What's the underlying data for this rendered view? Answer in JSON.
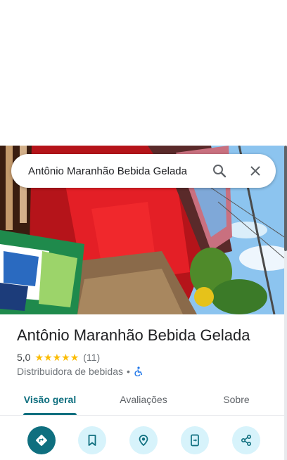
{
  "search": {
    "query": "Antônio Maranhão Bebida Gelada"
  },
  "place": {
    "name": "Antônio Maranhão Bebida Gelada",
    "rating": "5,0",
    "stars": [
      "★",
      "★",
      "★",
      "★",
      "★"
    ],
    "review_count": "(11)",
    "category": "Distribuidora de bebidas",
    "separator": "•"
  },
  "tabs": [
    {
      "label": "Visão geral",
      "active": true
    },
    {
      "label": "Avaliações",
      "active": false
    },
    {
      "label": "Sobre",
      "active": false
    }
  ],
  "actions": [
    {
      "icon": "directions-icon"
    },
    {
      "icon": "save-icon"
    },
    {
      "icon": "nearby-icon"
    },
    {
      "icon": "send-to-phone-icon"
    },
    {
      "icon": "share-icon"
    }
  ],
  "colors": {
    "accent": "#0f6f7f",
    "action_bg": "#d7f3fb",
    "star": "#fbbc04",
    "accessibility": "#1a73e8"
  }
}
